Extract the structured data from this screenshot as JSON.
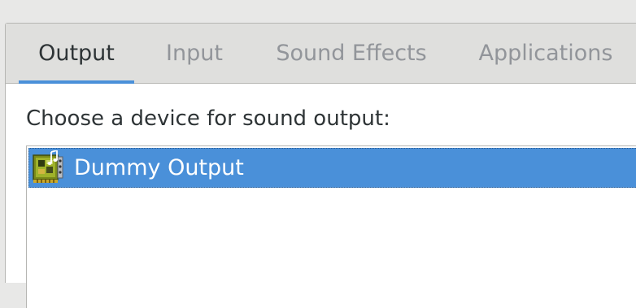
{
  "tabs": [
    {
      "label": "Output",
      "active": true
    },
    {
      "label": "Input",
      "active": false
    },
    {
      "label": "Sound Effects",
      "active": false
    },
    {
      "label": "Applications",
      "active": false
    }
  ],
  "output": {
    "section_label": "Choose a device for sound output:",
    "devices": [
      {
        "label": "Dummy Output",
        "icon": "sound-card-icon",
        "selected": true
      }
    ]
  },
  "colors": {
    "accent": "#4a90d9",
    "tab_bar_bg": "#dfdfdd",
    "window_bg": "#e8e8e7",
    "active_text": "#2e3436",
    "inactive_text": "#92959a"
  }
}
